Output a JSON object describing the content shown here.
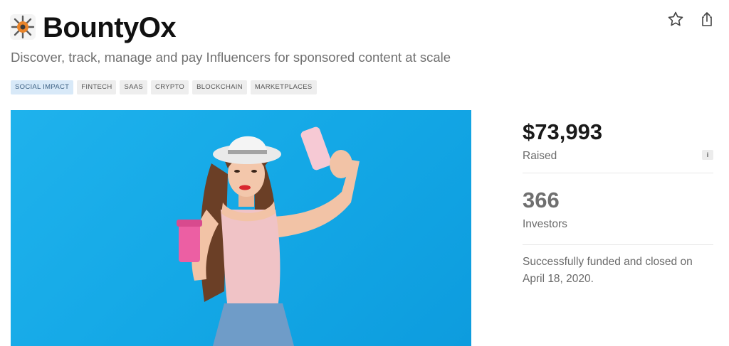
{
  "company": {
    "name": "BountyOx",
    "tagline": "Discover, track, manage and pay Influencers for sponsored content at scale"
  },
  "tags": [
    {
      "label": "SOCIAL IMPACT",
      "highlighted": true
    },
    {
      "label": "FINTECH",
      "highlighted": false
    },
    {
      "label": "SAAS",
      "highlighted": false
    },
    {
      "label": "CRYPTO",
      "highlighted": false
    },
    {
      "label": "BLOCKCHAIN",
      "highlighted": false
    },
    {
      "label": "MARKETPLACES",
      "highlighted": false
    }
  ],
  "stats": {
    "raised_amount": "$73,993",
    "raised_label": "Raised",
    "info_glyph": "i",
    "investors_count": "366",
    "investors_label": "Investors",
    "status_text": "Successfully funded and closed on April 18, 2020."
  },
  "icons": {
    "logo": "bountyox-logo-icon",
    "favorite": "star-icon",
    "share": "share-icon"
  },
  "colors": {
    "hero_background": "#14a8e6",
    "tag_highlight": "#d8e9f8"
  }
}
